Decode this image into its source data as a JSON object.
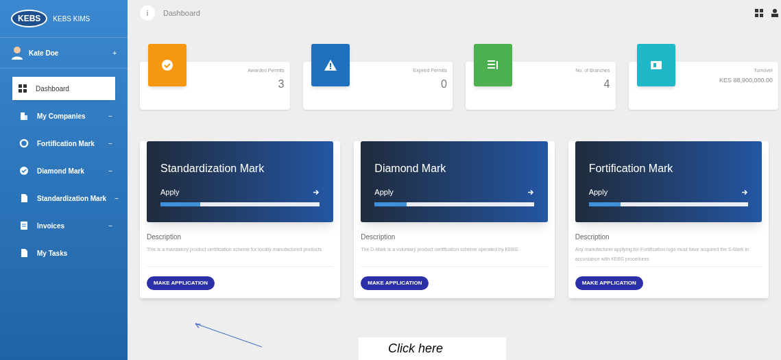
{
  "sidebar": {
    "brand": {
      "logo": "KEBS",
      "title": "KEBS KIMS"
    },
    "user": {
      "name": "Kate Doe",
      "caret": "+"
    },
    "items": [
      {
        "label": "Dashboard",
        "selected": true
      },
      {
        "label": "My Companies",
        "selected": false,
        "caret": "−"
      },
      {
        "label": "Fortification Mark",
        "selected": false,
        "caret": "−"
      },
      {
        "label": "Diamond Mark",
        "selected": false,
        "caret": "−"
      },
      {
        "label": "Standardization Mark",
        "selected": false,
        "caret": "−"
      },
      {
        "label": "Invoices",
        "selected": false,
        "caret": "−"
      },
      {
        "label": "My Tasks",
        "selected": false
      }
    ]
  },
  "topbar": {
    "info_icon": "i",
    "title": "Dashboard"
  },
  "stats": [
    {
      "label": "Awarded Permits",
      "value": "3",
      "color": "#f5970f"
    },
    {
      "label": "Expired Permits",
      "value": "0",
      "color": "#1f6fbf"
    },
    {
      "label": "No. of Branches",
      "value": "4",
      "color": "#4caf50"
    },
    {
      "label": "Turnover",
      "value": "KES 88,900,000.00",
      "color": "#1fb8c9"
    }
  ],
  "marks": [
    {
      "title": "Standardization Mark",
      "action": "Apply",
      "level": 0.25,
      "description_title": "Description",
      "description": "This is a mandatory product certification scheme for locally manufactured products",
      "button": "MAKE APPLICATION"
    },
    {
      "title": "Diamond Mark",
      "action": "Apply",
      "level": 0.2,
      "description_title": "Description",
      "description": "The D-Mark is a voluntary product certification scheme operated by KEBS",
      "button": "MAKE APPLICATION"
    },
    {
      "title": "Fortification Mark",
      "action": "Apply",
      "level": 0.2,
      "description_title": "Description",
      "description": "Any manufacturer applying for Fortification logo must have acquired the S-Mark in accordance with KEBS procedures",
      "button": "MAKE APPLICATION"
    }
  ],
  "annotation": {
    "text": "Click here"
  }
}
